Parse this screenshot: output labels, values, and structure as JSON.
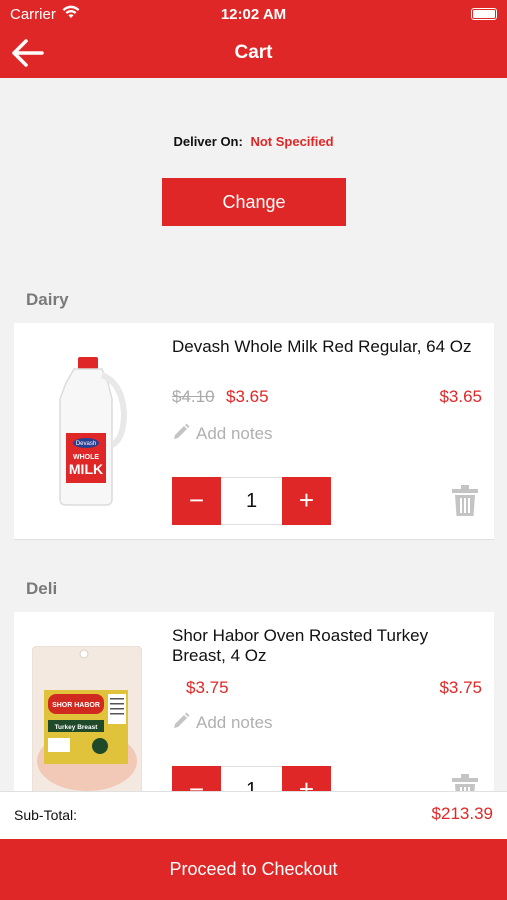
{
  "status_bar": {
    "carrier": "Carrier",
    "time": "12:02 AM"
  },
  "nav": {
    "title": "Cart",
    "back_icon": "arrow-left-icon"
  },
  "delivery": {
    "label": "Deliver On:",
    "value": "Not Specified",
    "change_label": "Change"
  },
  "sections": [
    {
      "title": "Dairy",
      "items": [
        {
          "name": "Devash Whole Milk Red Regular, 64 Oz",
          "old_price": "$4.10",
          "price": "$3.65",
          "total": "$3.65",
          "notes_placeholder": "Add notes",
          "quantity": "1"
        }
      ]
    },
    {
      "title": "Deli",
      "items": [
        {
          "name": "Shor Habor Oven Roasted Turkey Breast, 4 Oz",
          "price": "$3.75",
          "total": "$3.75",
          "notes_placeholder": "Add notes",
          "quantity": "1"
        }
      ]
    }
  ],
  "footer": {
    "subtotal_label": "Sub-Total:",
    "subtotal_value": "$213.39",
    "checkout_label": "Proceed to Checkout"
  },
  "product_art": {
    "milk_brand": "Devash",
    "milk_label_line1": "WHOLE",
    "milk_label_line2": "MILK",
    "turkey_brand": "SHOR HABOR",
    "turkey_label": "Turkey Breast"
  },
  "controls": {
    "minus": "−",
    "plus": "+"
  },
  "colors": {
    "accent": "#e02727",
    "background": "#f2f2f2",
    "muted_text": "#b0b0b0"
  }
}
